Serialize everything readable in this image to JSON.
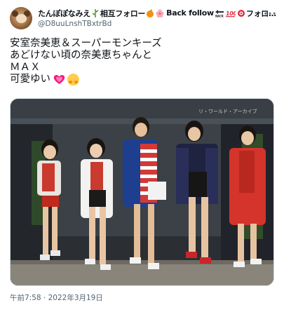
{
  "author": {
    "display_name_parts": [
      "たんぽぽなみえ",
      "相互フォロー",
      "Back follow",
      "フォロ…"
    ],
    "handle": "@D8uuLnshTBxtrBd",
    "avatar_icon": "dog-avatar-icon"
  },
  "menu": {
    "more_label": "···"
  },
  "tweet": {
    "lines": [
      "安室奈美恵＆スーパーモンキーズ",
      "あどけない頃の奈美恵ちゃんと",
      "ＭＡＸ",
      "可愛ゆい"
    ],
    "emojis": [
      "growing-heart-icon",
      "hugging-face-icon"
    ]
  },
  "photo": {
    "description_icon": "group-photo",
    "sign_text": "リ・ワールド・アーカイブ"
  },
  "timestamp": "午前7:58 · 2022年3月19日",
  "colors": {
    "text": "#0f1419",
    "secondary": "#536471",
    "border": "#cfd9de",
    "heart": "#f91880"
  }
}
